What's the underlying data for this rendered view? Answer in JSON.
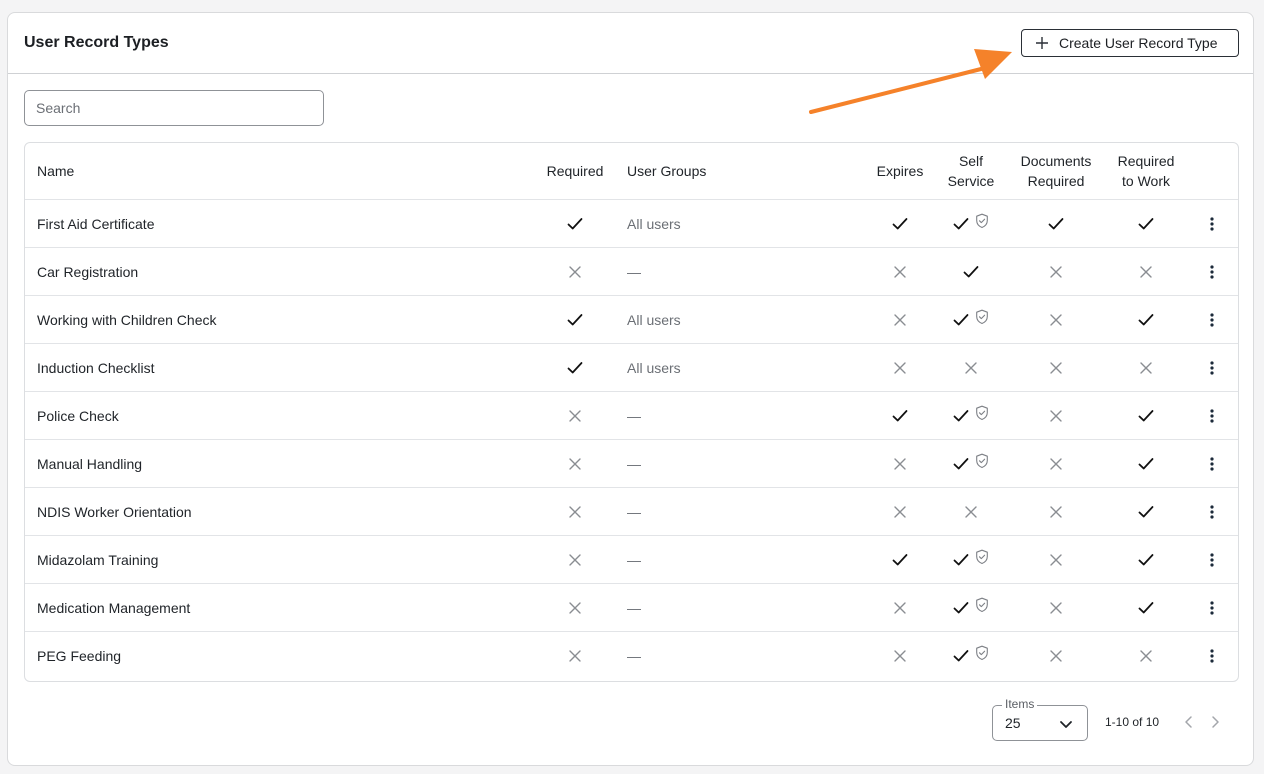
{
  "page": {
    "title": "User Record Types",
    "create_button": "Create User Record Type",
    "search_placeholder": "Search"
  },
  "table": {
    "headers": {
      "name": "Name",
      "required": "Required",
      "user_groups": "User Groups",
      "expires": "Expires",
      "self_service_1": "Self",
      "self_service_2": "Service",
      "documents_1": "Documents",
      "documents_2": "Required",
      "work_1": "Required",
      "work_2": "to Work"
    },
    "rows": [
      {
        "name": "First Aid Certificate",
        "required": true,
        "groups": "All users",
        "expires": true,
        "self_service": true,
        "self_service_protected": true,
        "documents": true,
        "work": true
      },
      {
        "name": "Car Registration",
        "required": false,
        "groups": "—",
        "expires": false,
        "self_service": true,
        "self_service_protected": false,
        "documents": false,
        "work": false
      },
      {
        "name": "Working with Children Check",
        "required": true,
        "groups": "All users",
        "expires": false,
        "self_service": true,
        "self_service_protected": true,
        "documents": false,
        "work": true
      },
      {
        "name": "Induction Checklist",
        "required": true,
        "groups": "All users",
        "expires": false,
        "self_service": false,
        "self_service_protected": false,
        "documents": false,
        "work": false
      },
      {
        "name": "Police Check",
        "required": false,
        "groups": "—",
        "expires": true,
        "self_service": true,
        "self_service_protected": true,
        "documents": false,
        "work": true
      },
      {
        "name": "Manual Handling",
        "required": false,
        "groups": "—",
        "expires": false,
        "self_service": true,
        "self_service_protected": true,
        "documents": false,
        "work": true
      },
      {
        "name": "NDIS Worker Orientation",
        "required": false,
        "groups": "—",
        "expires": false,
        "self_service": false,
        "self_service_protected": false,
        "documents": false,
        "work": true
      },
      {
        "name": "Midazolam Training",
        "required": false,
        "groups": "—",
        "expires": true,
        "self_service": true,
        "self_service_protected": true,
        "documents": false,
        "work": true
      },
      {
        "name": "Medication Management",
        "required": false,
        "groups": "—",
        "expires": false,
        "self_service": true,
        "self_service_protected": true,
        "documents": false,
        "work": true
      },
      {
        "name": "PEG Feeding",
        "required": false,
        "groups": "—",
        "expires": false,
        "self_service": true,
        "self_service_protected": true,
        "documents": false,
        "work": false
      }
    ]
  },
  "pagination": {
    "items_label": "Items",
    "items_value": "25",
    "range": "1-10 of 10"
  },
  "colors": {
    "accent_arrow": "#f5822a",
    "check": "#111111",
    "cross": "#8a8d92"
  },
  "icons": {
    "check": "check-icon",
    "cross": "cross-icon",
    "shield": "shield-check-icon",
    "kebab": "more-vertical-icon",
    "plus": "plus-icon",
    "chevron": "chevron-down-icon",
    "prev": "chevron-left-icon",
    "next": "chevron-right-icon"
  }
}
